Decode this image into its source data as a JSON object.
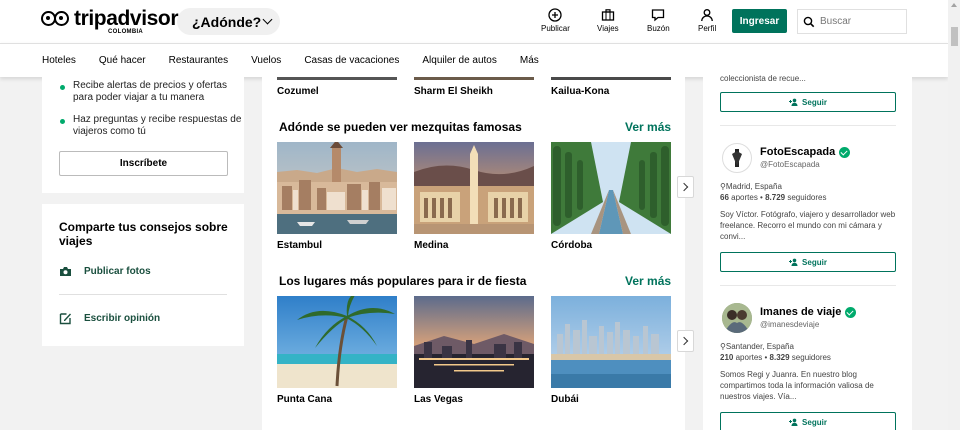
{
  "header": {
    "logo_brand": "tripadvisor",
    "logo_sub": "COLOMBIA",
    "where_label": "¿Adónde?",
    "nav": [
      {
        "label": "Publicar",
        "icon": "plus-circle-icon"
      },
      {
        "label": "Viajes",
        "icon": "briefcase-icon"
      },
      {
        "label": "Buzón",
        "icon": "message-icon"
      },
      {
        "label": "Perfil",
        "icon": "user-icon"
      }
    ],
    "ingresar_label": "Ingresar",
    "search_placeholder": "Buscar"
  },
  "subnav": [
    "Hoteles",
    "Qué hacer",
    "Restaurantes",
    "Vuelos",
    "Casas de vacaciones",
    "Alquiler de autos",
    "Más"
  ],
  "left": {
    "bullets": [
      "Recibe alertas de precios y ofertas para poder viajar a tu manera",
      "Haz preguntas y recibe respuestas de viajeros como tú"
    ],
    "inscribete_label": "Inscríbete",
    "share_title": "Comparte tus consejos sobre viajes",
    "publicar_fotos": "Publicar fotos",
    "escribir_opinion": "Escribir opinión"
  },
  "main": {
    "top_row": [
      "Cozumel",
      "Sharm El Sheikh",
      "Kailua-Kona"
    ],
    "sections": [
      {
        "title": "Adónde se pueden ver mezquitas famosas",
        "see_more": "Ver más",
        "cities": [
          "Estambul",
          "Medina",
          "Córdoba"
        ]
      },
      {
        "title": "Los lugares más populares para ir de fiesta",
        "see_more": "Ver más",
        "cities": [
          "Punta Cana",
          "Las Vegas",
          "Dubái"
        ]
      }
    ]
  },
  "right": {
    "top_text": "coleccionista de recue...",
    "seguir_label": "Seguir",
    "profiles": [
      {
        "name": "FotoEscapada",
        "handle": "@FotoEscapada",
        "location": "Madrid, España",
        "stats_aportes": "66",
        "stats_aportes_label": "aportes",
        "stats_seguidores": "8.729",
        "stats_seguidores_label": "seguidores",
        "bio": "Soy Víctor. Fotógrafo, viajero y desarrollador web freelance. Recorro el mundo con mi cámara y convi..."
      },
      {
        "name": "Imanes de viaje",
        "handle": "@imanesdeviaje",
        "location": "Santander, España",
        "stats_aportes": "210",
        "stats_aportes_label": "aportes",
        "stats_seguidores": "8.329",
        "stats_seguidores_label": "seguidores",
        "bio": "Somos Regi y Juanra. En nuestro blog compartimos toda la información valiosa de nuestros viajes. Vía..."
      }
    ]
  },
  "colors": {
    "brand_green": "#00735c",
    "bullet_green": "#00aa6c"
  }
}
